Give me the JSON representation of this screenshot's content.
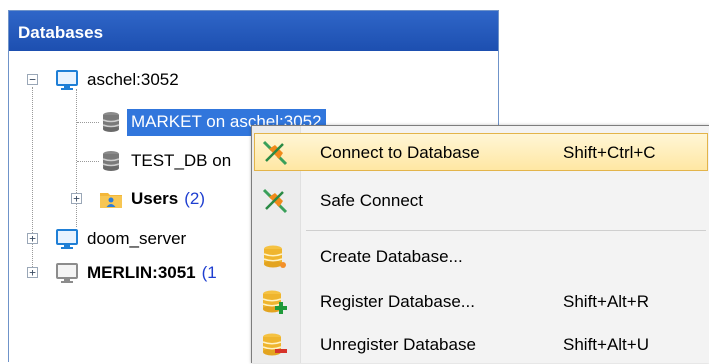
{
  "panel": {
    "title": "Databases"
  },
  "tree": {
    "servers": [
      {
        "label": "aschel:3052",
        "children": [
          {
            "label": "MARKET on aschel:3052",
            "selected": true
          },
          {
            "label": "TEST_DB on"
          },
          {
            "label": "Users",
            "count": "(2)"
          }
        ]
      },
      {
        "label": "doom_server"
      },
      {
        "label": "MERLIN:3051",
        "count": "(1"
      }
    ]
  },
  "context_menu": {
    "items": [
      {
        "label": "Connect to Database",
        "shortcut": "Shift+Ctrl+C",
        "icon": "connect-plug-icon",
        "highlighted": true
      },
      {
        "label": "Safe Connect",
        "shortcut": "",
        "icon": "safe-connect-plug-icon"
      },
      {
        "label": "Create Database...",
        "shortcut": "",
        "icon": "create-database-icon"
      },
      {
        "label": "Register Database...",
        "shortcut": "Shift+Alt+R",
        "icon": "register-database-icon"
      },
      {
        "label": "Unregister Database",
        "shortcut": "Shift+Alt+U",
        "icon": "unregister-database-icon"
      }
    ]
  },
  "colors": {
    "header": "#2f66c8",
    "selection": "#3176dc",
    "count": "#1f3fd0",
    "menu_highlight": "#ffe7a3"
  }
}
